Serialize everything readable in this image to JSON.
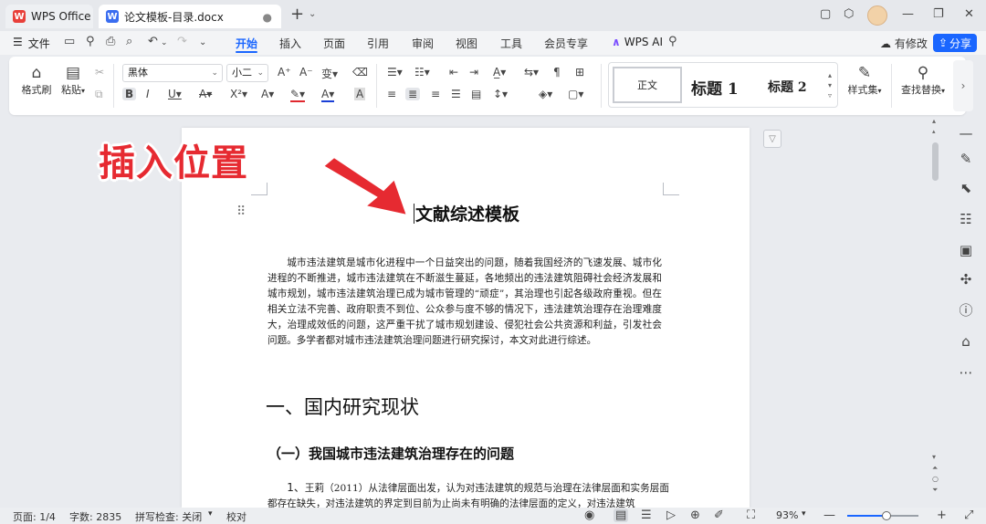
{
  "tabs": [
    {
      "label": "WPS Office",
      "logo": "W"
    },
    {
      "label": "论文模板-目录.docx",
      "logo": "W"
    }
  ],
  "menu": {
    "file": "文件",
    "items": [
      "开始",
      "插入",
      "页面",
      "引用",
      "审阅",
      "视图",
      "工具",
      "会员专享"
    ],
    "active": "开始",
    "wps_ai": "WPS AI",
    "edit_status": "有修改",
    "share": "分享"
  },
  "ribbon": {
    "format_painter": "格式刷",
    "paste": "粘贴",
    "font_name": "黑体",
    "font_size": "小二",
    "styles": {
      "normal": "正文",
      "h1": "标题 1",
      "h2": "标题 2"
    },
    "style_set": "样式集",
    "find_replace": "查找替换"
  },
  "document": {
    "title": "文献综述模板",
    "paragraph": "城市违法建筑是城市化进程中一个日益突出的问题，随着我国经济的飞速发展、城市化进程的不断推进，城市违法建筑在不断滋生蔓延，各地频出的违法建筑阻碍社会经济发展和城市规划，城市违法建筑治理已成为城市管理的“顽症”，其治理也引起各级政府重视。但在相关立法不完善、政府职责不到位、公众参与度不够的情况下，违法建筑治理存在治理难度大，治理成效低的问题，这严重干扰了城市规划建设、侵犯社会公共资源和利益，引发社会问题。多学者都对城市违法建筑治理问题进行研究探讨，本文对此进行综述。",
    "heading1": "一、国内研究现状",
    "heading2": "（一）我国城市违法建筑治理存在的问题",
    "item_number": "1、",
    "item_text": "王莉（2011）从法律层面出发，认为对违法建筑的规范与治理在法律层面和实务层面都存在缺失，对违法建筑的界定到目前为止尚未有明确的法律层面的定义，对违法建筑"
  },
  "annotation": {
    "label": "插入位置",
    "color": "#e62a31"
  },
  "status": {
    "page": "页面: 1/4",
    "words": "字数: 2835",
    "spellcheck": "拼写检查: 关闭",
    "proofread": "校对",
    "zoom": "93%",
    "zoom_fraction": 0.55
  },
  "colors": {
    "accent": "#1a66ff",
    "wps_logo": "#e8403a",
    "doc_logo": "#3a6df0",
    "font_red": "#e0282e",
    "font_blue": "#1a3fd6"
  }
}
